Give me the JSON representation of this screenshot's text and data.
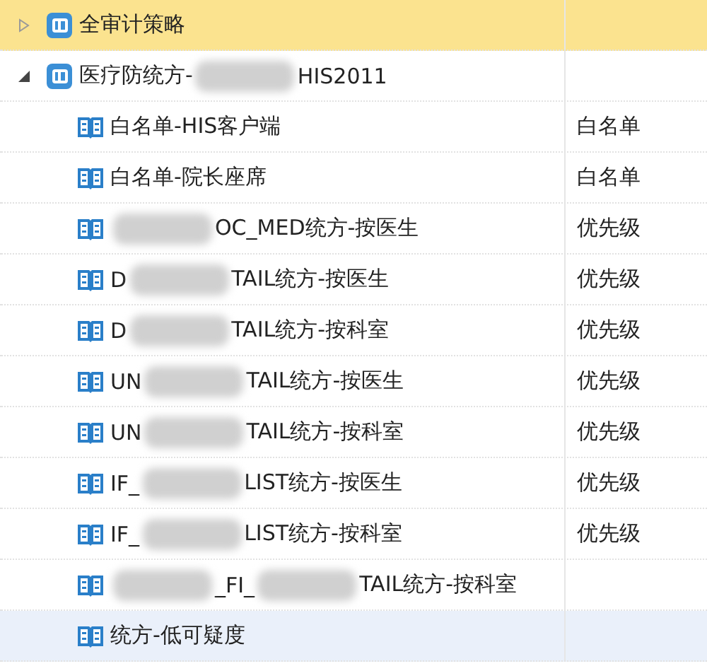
{
  "tree": [
    {
      "kind": "policy",
      "expanded": false,
      "selected": true,
      "hovered": false,
      "segments": [
        {
          "text": "全审计策略"
        }
      ]
    },
    {
      "kind": "policy",
      "expanded": true,
      "selected": false,
      "hovered": false,
      "segments": [
        {
          "text": "医疗防统方-"
        },
        {
          "kind": "redacted"
        },
        {
          "text": "HIS2011"
        }
      ],
      "children": [
        {
          "kind": "rule",
          "selected": false,
          "hovered": false,
          "segments": [
            {
              "text": "白名单-HIS客户端"
            }
          ],
          "type": "白名单"
        },
        {
          "kind": "rule",
          "selected": false,
          "hovered": false,
          "segments": [
            {
              "text": "白名单-院长座席"
            }
          ],
          "type": "白名单"
        },
        {
          "kind": "rule",
          "selected": false,
          "hovered": false,
          "segments": [
            {
              "kind": "redacted"
            },
            {
              "text": "OC_MED统方-按医生"
            }
          ],
          "type": "优先级"
        },
        {
          "kind": "rule",
          "selected": false,
          "hovered": false,
          "segments": [
            {
              "text": "D"
            },
            {
              "kind": "redacted"
            },
            {
              "text": "TAIL统方-按医生"
            }
          ],
          "type": "优先级"
        },
        {
          "kind": "rule",
          "selected": false,
          "hovered": false,
          "segments": [
            {
              "text": "D"
            },
            {
              "kind": "redacted"
            },
            {
              "text": "TAIL统方-按科室"
            }
          ],
          "type": "优先级"
        },
        {
          "kind": "rule",
          "selected": false,
          "hovered": false,
          "segments": [
            {
              "text": "UN"
            },
            {
              "kind": "redacted"
            },
            {
              "text": "TAIL统方-按医生"
            }
          ],
          "type": "优先级"
        },
        {
          "kind": "rule",
          "selected": false,
          "hovered": false,
          "segments": [
            {
              "text": "UN"
            },
            {
              "kind": "redacted"
            },
            {
              "text": "TAIL统方-按科室"
            }
          ],
          "type": "优先级"
        },
        {
          "kind": "rule",
          "selected": false,
          "hovered": false,
          "segments": [
            {
              "text": "IF_"
            },
            {
              "kind": "redacted"
            },
            {
              "text": "LIST统方-按医生"
            }
          ],
          "type": "优先级"
        },
        {
          "kind": "rule",
          "selected": false,
          "hovered": false,
          "segments": [
            {
              "text": "IF_"
            },
            {
              "kind": "redacted"
            },
            {
              "text": "LIST统方-按科室"
            }
          ],
          "type": "优先级"
        },
        {
          "kind": "rule",
          "selected": false,
          "hovered": false,
          "segments": [
            {
              "kind": "redacted"
            },
            {
              "text": "_FI_"
            },
            {
              "kind": "redacted"
            },
            {
              "text": "TAIL统方-按科室"
            }
          ]
        },
        {
          "kind": "rule",
          "selected": false,
          "hovered": true,
          "segments": [
            {
              "text": "统方-低可疑度"
            }
          ]
        }
      ]
    }
  ]
}
